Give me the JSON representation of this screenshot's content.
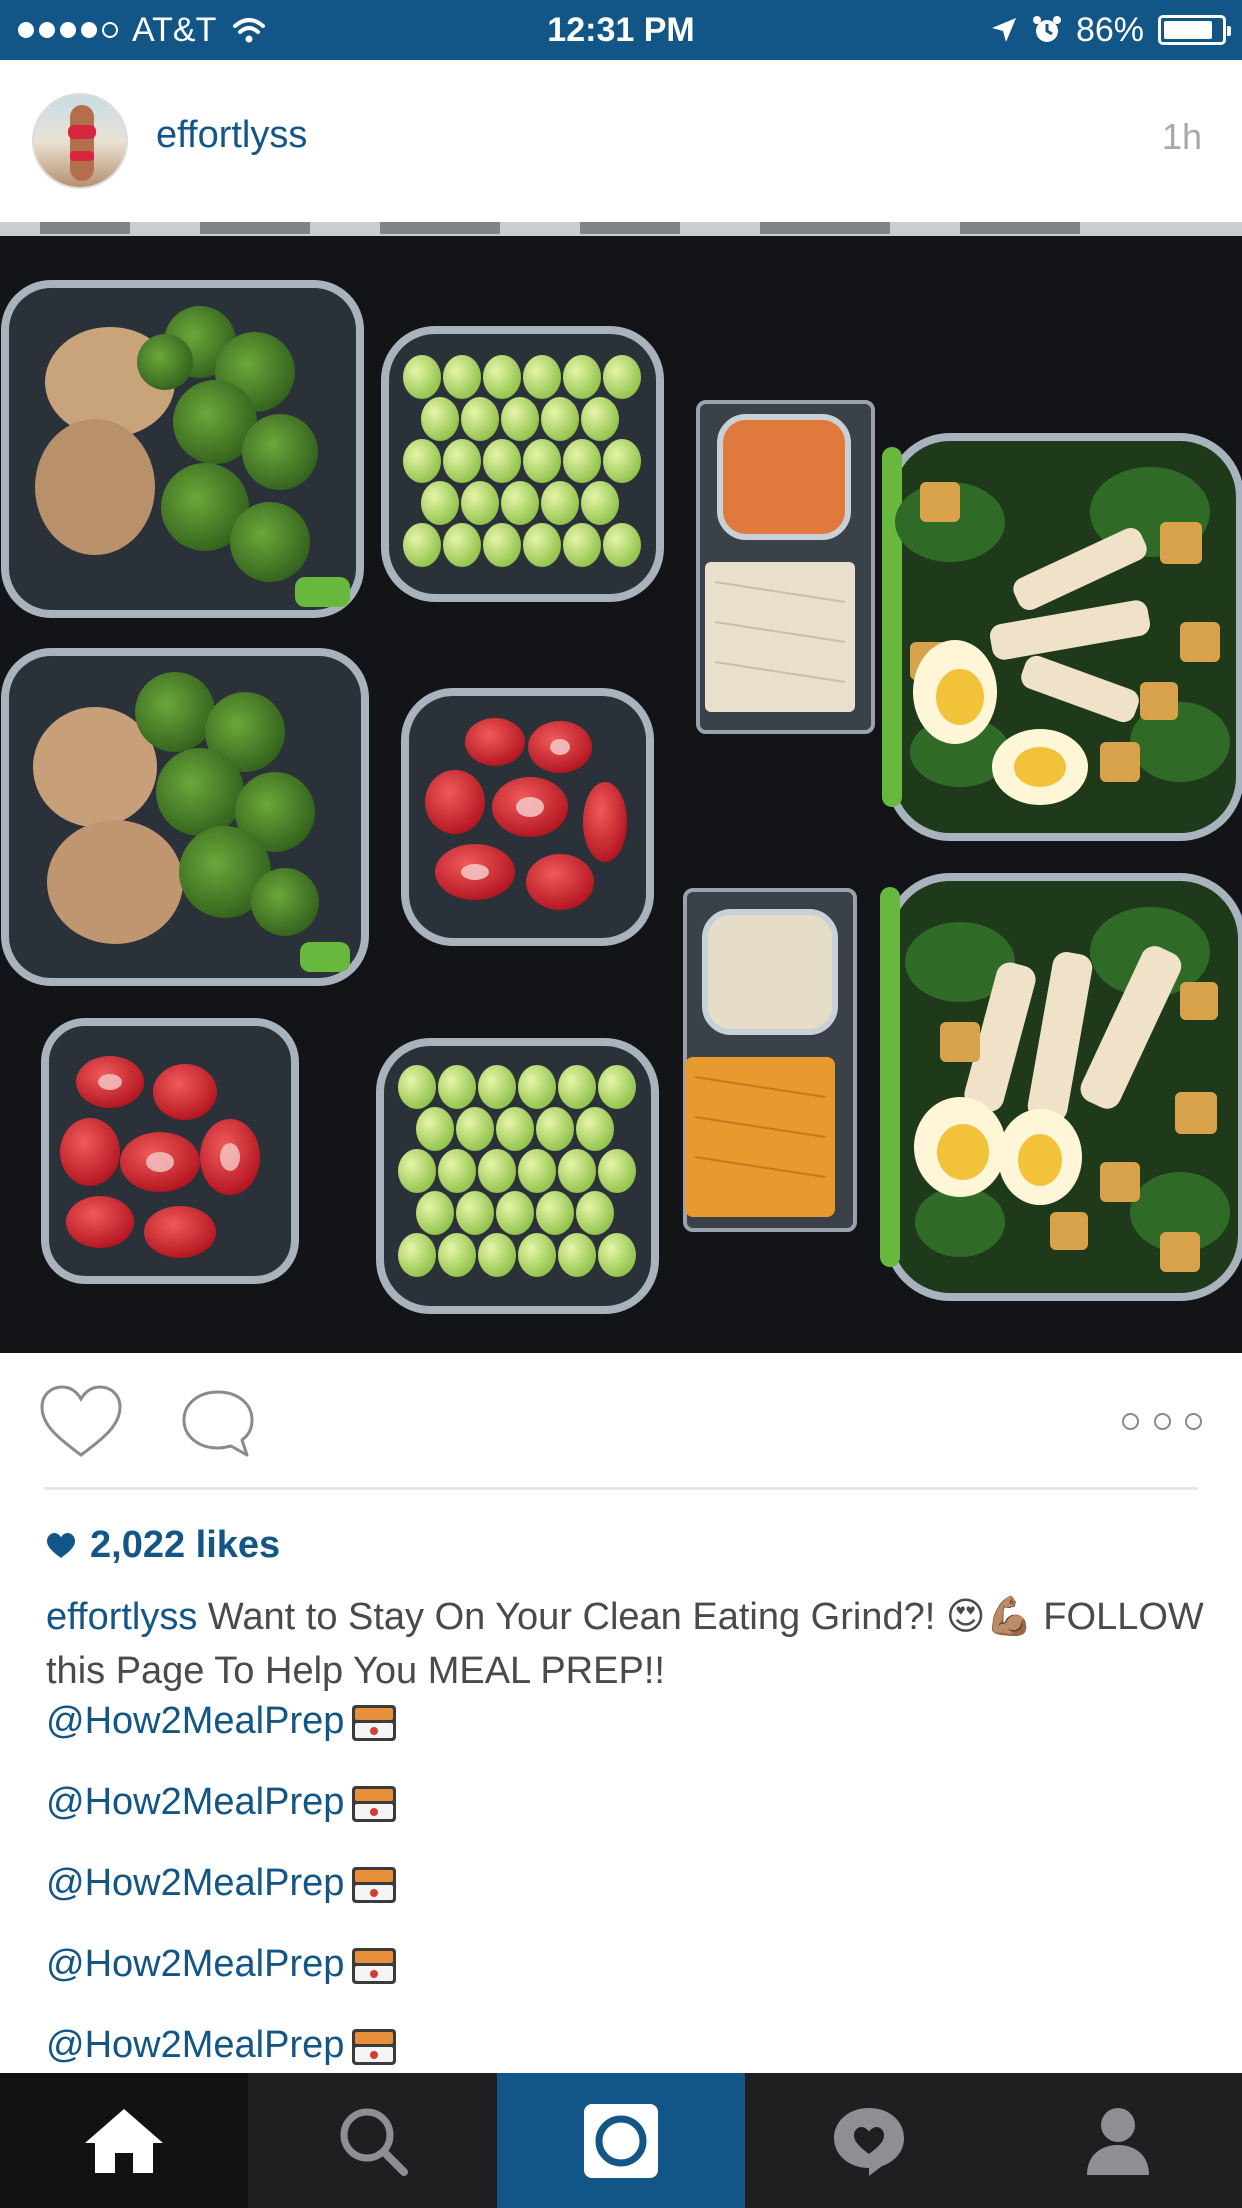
{
  "status_bar": {
    "carrier": "AT&T",
    "time": "12:31 PM",
    "battery": "86%",
    "battery_level": 0.86,
    "icons": [
      "signal-dots-icon",
      "wifi-icon",
      "location-arrow-icon",
      "alarm-icon",
      "battery-icon"
    ]
  },
  "post": {
    "username": "effortlyss",
    "timestamp": "1h",
    "likes": "2,022 likes",
    "caption_user": "effortlyss",
    "caption_text": "Want to Stay On Your Clean Eating Grind?! 😍💪🏽 FOLLOW this Page To Help You MEAL PREP!!",
    "mentions": [
      "@How2MealPrep",
      "@How2MealPrep",
      "@How2MealPrep",
      "@How2MealPrep",
      "@How2MealPrep"
    ]
  },
  "actions": {
    "icons": [
      "heart-outline-icon",
      "comment-bubble-icon",
      "more-options-icon"
    ]
  },
  "tabbar": {
    "tabs": [
      "home",
      "search",
      "camera",
      "activity",
      "profile"
    ],
    "active": "home"
  },
  "colors": {
    "brand": "#125688",
    "tabbar_bg": "#1f1f21",
    "text_gray": "#4a4a4a",
    "timestamp_gray": "#a8a8a8"
  }
}
